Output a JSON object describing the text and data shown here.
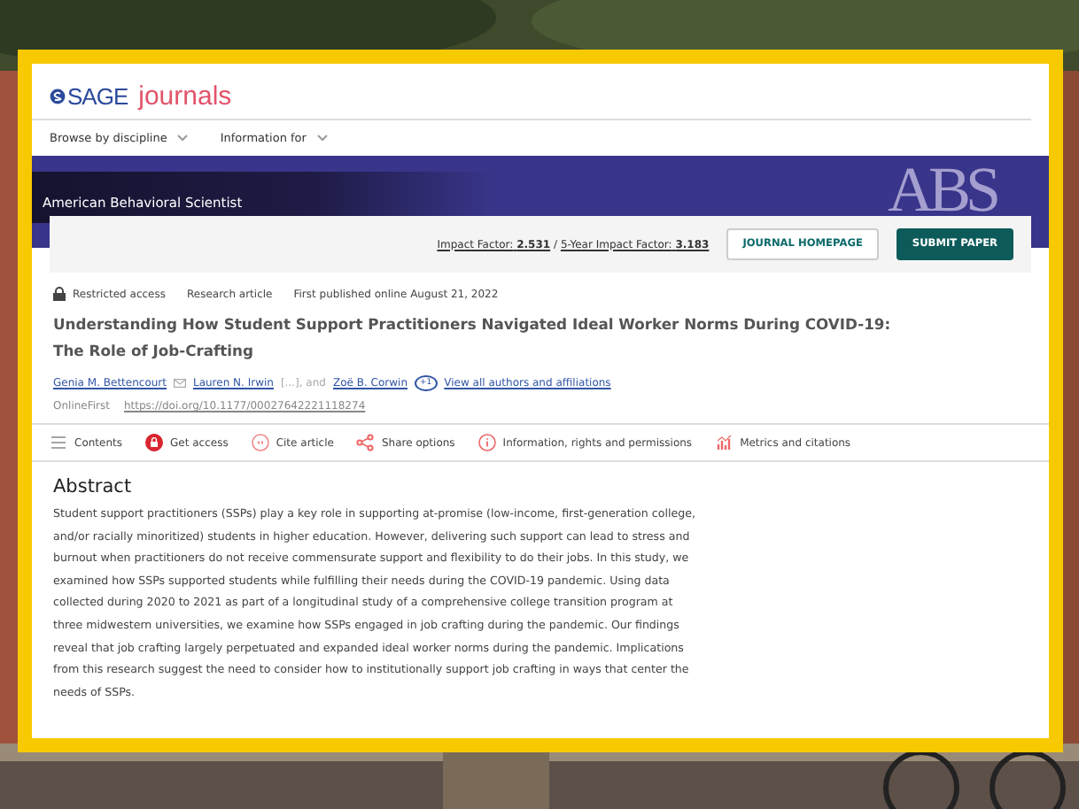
{
  "site": {
    "logo_mark": "SAGE",
    "logo_word": "journals"
  },
  "nav": [
    {
      "label": "Browse by discipline",
      "expanded": false
    },
    {
      "label": "Information for",
      "expanded": false
    }
  ],
  "journal": {
    "name": "American Behavioral Scientist",
    "banner_logo": "ABS"
  },
  "metrics": {
    "impact_label": "Impact Factor:",
    "impact_value": "2.531",
    "separator": "/",
    "five_year_label": "5-Year Impact Factor:",
    "five_year_value": "3.183"
  },
  "buttons": [
    {
      "label": "JOURNAL HOMEPAGE",
      "kind": "outline"
    },
    {
      "label": "SUBMIT PAPER",
      "kind": "filled"
    }
  ],
  "article": {
    "access": "Restricted access",
    "type": "Research article",
    "published": "First published online August 21, 2022",
    "title": "Understanding How Student Support Practitioners Navigated Ideal Worker Norms During COVID-19: The Role of Job-Crafting",
    "authors": [
      {
        "name": "Genia M. Bettencourt",
        "email": true
      },
      {
        "name": "Lauren N. Irwin",
        "email": false
      }
    ],
    "elided": "[...], and",
    "last_author": "Zoë B. Corwin",
    "more_count": "+1",
    "view_all": "View all authors and affiliations",
    "status": "OnlineFirst",
    "doi": "https://doi.org/10.1177/00027642221118274"
  },
  "tools": [
    {
      "label": "Contents",
      "kind": "contents"
    },
    {
      "label": "Get access",
      "kind": "access"
    },
    {
      "label": "Cite article",
      "kind": "cite"
    },
    {
      "label": "Share options",
      "kind": "share"
    },
    {
      "label": "Information, rights and permissions",
      "kind": "info"
    },
    {
      "label": "Metrics and citations",
      "kind": "metrics"
    }
  ],
  "abstract": {
    "heading": "Abstract",
    "text": "Student support practitioners (SSPs) play a key role in supporting at-promise (low-income, first-generation college, and/or racially minoritized) students in higher education. However, delivering such support can lead to stress and burnout when practitioners do not receive commensurate support and flexibility to do their jobs. In this study, we examined how SSPs supported students while fulfilling their needs during the COVID-19 pandemic. Using data collected during 2020 to 2021 as part of a longitudinal study of a comprehensive college transition program at three midwestern universities, we examine how SSPs engaged in job crafting during the pandemic. Our findings reveal that job crafting largely perpetuated and expanded ideal worker norms during the pandemic. Implications from this research suggest the need to consider how to institutionally support job crafting in ways that center the needs of SSPs."
  }
}
